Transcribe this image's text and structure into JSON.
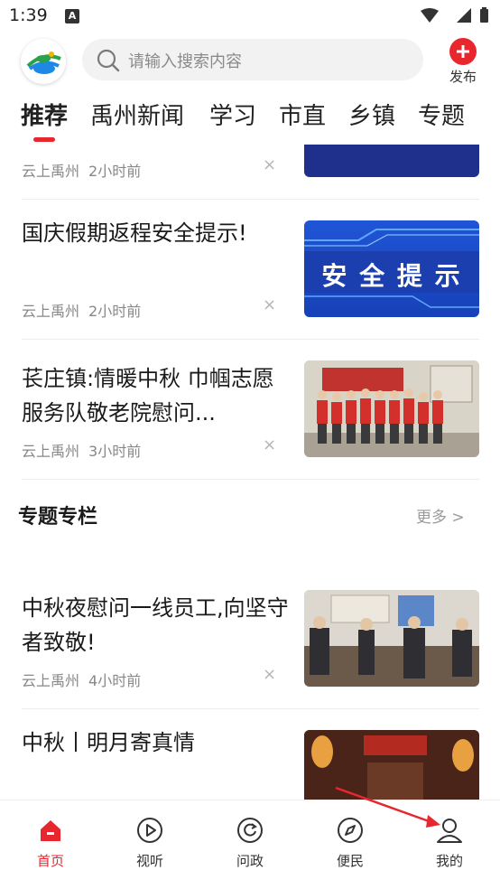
{
  "status_bar": {
    "time": "1:39",
    "notification_letter": "A"
  },
  "header": {
    "search_placeholder": "请输入搜索内容",
    "publish_label": "发布"
  },
  "tabs": [
    {
      "label": "推荐",
      "active": true
    },
    {
      "label": "禹州新闻",
      "active": false
    },
    {
      "label": "学习",
      "active": false
    },
    {
      "label": "市直",
      "active": false
    },
    {
      "label": "乡镇",
      "active": false
    },
    {
      "label": "专题",
      "active": false
    }
  ],
  "feed": {
    "articles": [
      {
        "title": "",
        "source": "云上禹州",
        "time": "2小时前",
        "close": "×"
      },
      {
        "title": "国庆假期返程安全提示!",
        "source": "云上禹州",
        "time": "2小时前",
        "close": "×",
        "image_text": "安 全 提 示"
      },
      {
        "title": "苌庄镇:情暖中秋 巾帼志愿服务队敬老院慰问...",
        "source": "云上禹州",
        "time": "3小时前",
        "close": "×"
      },
      {
        "title": "中秋夜慰问一线员工,向坚守者致敬!",
        "source": "云上禹州",
        "time": "4小时前",
        "close": "×"
      },
      {
        "title": "中秋丨明月寄真情",
        "source": "",
        "time": "",
        "close": ""
      }
    ],
    "section": {
      "title": "专题专栏",
      "more": "更多 >"
    }
  },
  "bottom_nav": [
    {
      "label": "首页",
      "icon": "home-icon",
      "active": true
    },
    {
      "label": "视听",
      "icon": "play-icon",
      "active": false
    },
    {
      "label": "问政",
      "icon": "refresh-icon",
      "active": false
    },
    {
      "label": "便民",
      "icon": "compass-icon",
      "active": false
    },
    {
      "label": "我的",
      "icon": "user-icon",
      "active": false
    }
  ],
  "colors": {
    "accent": "#e8262e",
    "annotation_arrow": "#e8262e"
  }
}
